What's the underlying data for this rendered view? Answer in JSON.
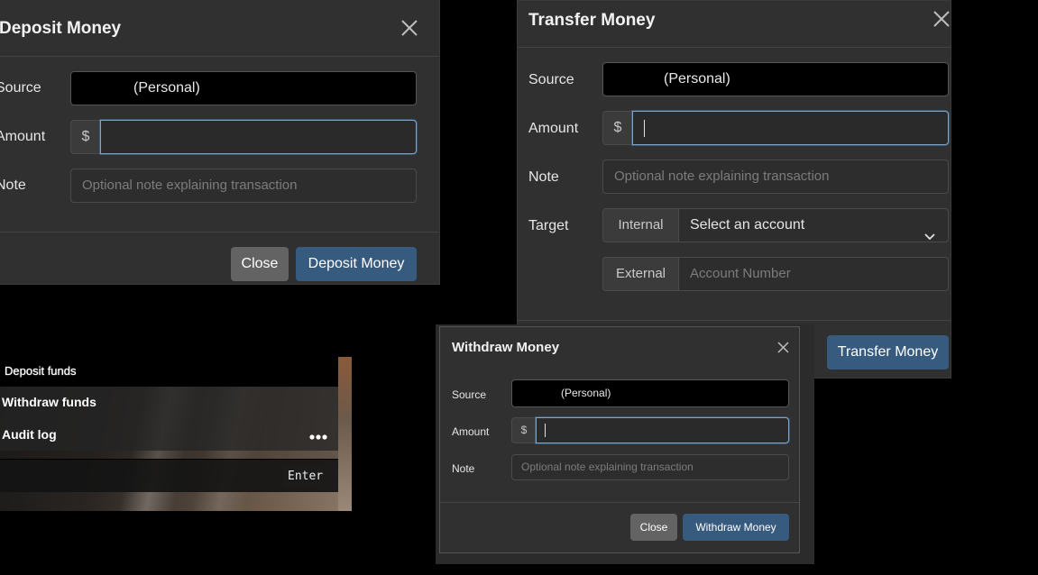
{
  "deposit": {
    "title": "Deposit Money",
    "source_label": "Source",
    "source_value": "(Personal)",
    "amount_label": "Amount",
    "currency": "$",
    "note_label": "Note",
    "note_placeholder": "Optional note explaining transaction",
    "close_label": "Close",
    "submit_label": "Deposit Money"
  },
  "transfer": {
    "title": "Transfer Money",
    "source_label": "Source",
    "source_value": "(Personal)",
    "amount_label": "Amount",
    "currency": "$",
    "note_label": "Note",
    "note_placeholder": "Optional note explaining transaction",
    "target_label": "Target",
    "internal_label": "Internal",
    "account_select": "Select an account",
    "external_label": "External",
    "account_number_placeholder": "Account Number",
    "submit_label": "Transfer Money"
  },
  "withdraw": {
    "title": "Withdraw Money",
    "source_label": "Source",
    "source_value": "(Personal)",
    "amount_label": "Amount",
    "currency": "$",
    "note_label": "Note",
    "note_placeholder": "Optional note explaining transaction",
    "close_label": "Close",
    "submit_label": "Withdraw Money"
  },
  "menu": {
    "items": [
      "Deposit funds",
      "Withdraw funds",
      "Audit log"
    ],
    "more_icon": "more-dots-icon",
    "enter_key": "Enter"
  },
  "colors": {
    "background": "#000000",
    "modal": "#303030",
    "primary_button": "#375a7f",
    "secondary_button": "#636363",
    "focus_border": "#7fa4c9"
  }
}
